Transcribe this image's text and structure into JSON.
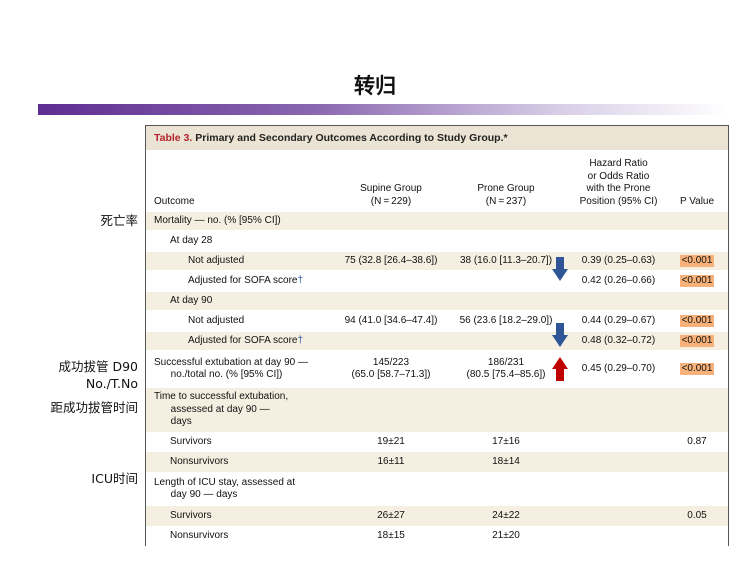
{
  "slide": {
    "title": "转归",
    "left_labels": [
      "死亡率",
      "成功拔管 D90",
      "No./T.No",
      "距成功拔管时间",
      "ICU时间"
    ]
  },
  "table": {
    "caption_label": "Table 3.",
    "caption_text": "Primary and Secondary Outcomes According to Study Group.*",
    "headers": {
      "outcome": "Outcome",
      "supine": "Supine Group\n(N = 229)",
      "prone": "Prone Group\n(N = 237)",
      "hr": "Hazard Ratio\nor Odds Ratio\nwith the Prone\nPosition (95% CI)",
      "p": "P Value"
    },
    "rows": [
      {
        "outcome": "Mortality — no. (% [95% CI])",
        "supine": "",
        "prone": "",
        "hr": "",
        "p": ""
      },
      {
        "outcome": "At day 28",
        "supine": "",
        "prone": "",
        "hr": "",
        "p": ""
      },
      {
        "outcome": "Not adjusted",
        "supine": "75 (32.8 [26.4–38.6])",
        "prone": "38 (16.0 [11.3–20.7])",
        "hr": "0.39 (0.25–0.63)",
        "p": "<0.001"
      },
      {
        "outcome": "Adjusted for SOFA score",
        "dagger": "†",
        "supine": "",
        "prone": "",
        "hr": "0.42 (0.26–0.66)",
        "p": "<0.001"
      },
      {
        "outcome": "At day 90",
        "supine": "",
        "prone": "",
        "hr": "",
        "p": ""
      },
      {
        "outcome": "Not adjusted",
        "supine": "94 (41.0 [34.6–47.4])",
        "prone": "56 (23.6 [18.2–29.0])",
        "hr": "0.44 (0.29–0.67)",
        "p": "<0.001"
      },
      {
        "outcome": "Adjusted for SOFA score",
        "dagger": "†",
        "supine": "",
        "prone": "",
        "hr": "0.48 (0.32–0.72)",
        "p": "<0.001"
      },
      {
        "outcome": "Successful extubation at day 90 —\n      no./total no. (% [95% CI])",
        "supine": "145/223\n(65.0 [58.7–71.3])",
        "prone": "186/231\n(80.5 [75.4–85.6])",
        "hr": "0.45 (0.29–0.70)",
        "p": "<0.001"
      },
      {
        "outcome": "Time to successful extubation,\n      assessed at day 90 —\n      days",
        "supine": "",
        "prone": "",
        "hr": "",
        "p": ""
      },
      {
        "outcome": "Survivors",
        "supine": "19±21",
        "prone": "17±16",
        "hr": "",
        "p": "0.87"
      },
      {
        "outcome": "Nonsurvivors",
        "supine": "16±11",
        "prone": "18±14",
        "hr": "",
        "p": ""
      },
      {
        "outcome": "Length of ICU stay, assessed at\n      day 90 — days",
        "supine": "",
        "prone": "",
        "hr": "",
        "p": ""
      },
      {
        "outcome": "Survivors",
        "supine": "26±27",
        "prone": "24±22",
        "hr": "",
        "p": "0.05"
      },
      {
        "outcome": "Nonsurvivors",
        "supine": "18±15",
        "prone": "21±20",
        "hr": "",
        "p": ""
      }
    ]
  },
  "annotations": {
    "arrow_colors": {
      "down": "#2f5597",
      "up": "#c00000"
    },
    "highlight_color": "#f6b27a"
  }
}
